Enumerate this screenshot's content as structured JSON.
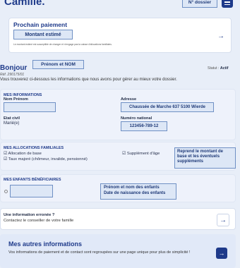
{
  "header": {
    "greeting_name": "Camille.",
    "dossier_label": "N° dossier",
    "menu_icon": "menu-icon"
  },
  "payment": {
    "title": "Prochain paiement",
    "amount_placeholder": "Montant estimé",
    "note": "Le montant estimé est susceptible de changer et n'engage pas la caisse d'allocations familiales."
  },
  "profile": {
    "hello": "Bonjour",
    "name_placeholder": "Prénom et NOM",
    "ref": "Réf. 290175/01",
    "status_label": "Statut :",
    "status_value": "Actif",
    "intro": "Vous trouverez ci-dessous les informations que nous avons pour gérer au mieux votre dossier."
  },
  "info": {
    "section_title": "MES INFORMATIONS",
    "nom_label": "Nom Prénom",
    "adresse_label": "Adresse",
    "adresse_value": "Chaussée de Marche 637 5100 Wierde",
    "etat_label": "Etat civil",
    "etat_value": "Marié(e)",
    "numero_label": "Numéro national",
    "numero_value": "123456-789-12"
  },
  "allocations": {
    "section_title": "MES ALLOCATIONS FAMILIALES",
    "items": [
      "Allocation de base",
      "Taux majoré (chômeur, invalide, pensionné)",
      "Supplément d'âge"
    ],
    "callout": "Reprend le montant de base et les éventuels suppléments"
  },
  "children": {
    "section_title": "MES ENFANTS BÉNÉFICIAIRES",
    "callout_line1": "Prénom et nom des enfants",
    "callout_line2": "Date de naissance des enfants"
  },
  "error_card": {
    "title": "Une information erronée ?",
    "text": "Contactez le conseiller de votre famille"
  },
  "more": {
    "title": "Mes autres informations",
    "text": "Vos informations de paiement et de contact sont regroupées sur une page unique pour plus de simplicité !"
  }
}
